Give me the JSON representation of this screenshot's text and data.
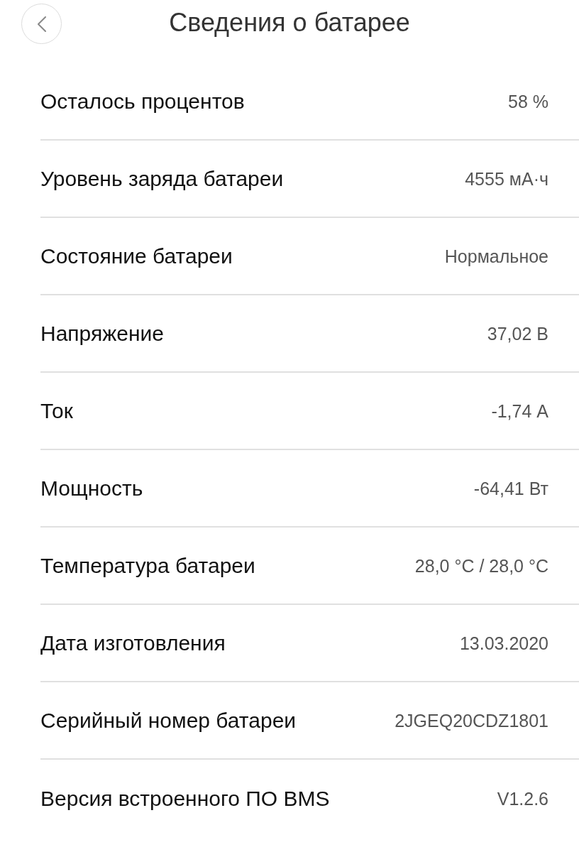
{
  "header": {
    "title": "Сведения о батарее"
  },
  "rows": [
    {
      "label": "Осталось процентов",
      "value": "58 %"
    },
    {
      "label": "Уровень заряда батареи",
      "value": "4555 мА·ч"
    },
    {
      "label": "Состояние батареи",
      "value": "Нормальное"
    },
    {
      "label": "Напряжение",
      "value": "37,02 В"
    },
    {
      "label": "Ток",
      "value": "-1,74 А"
    },
    {
      "label": "Мощность",
      "value": "-64,41 Вт"
    },
    {
      "label": "Температура батареи",
      "value": "28,0 °C / 28,0 °C"
    },
    {
      "label": "Дата изготовления",
      "value": "13.03.2020"
    },
    {
      "label": "Серийный номер батареи",
      "value": "2JGEQ20CDZ1801"
    },
    {
      "label": "Версия встроенного ПО BMS",
      "value": "V1.2.6"
    }
  ]
}
